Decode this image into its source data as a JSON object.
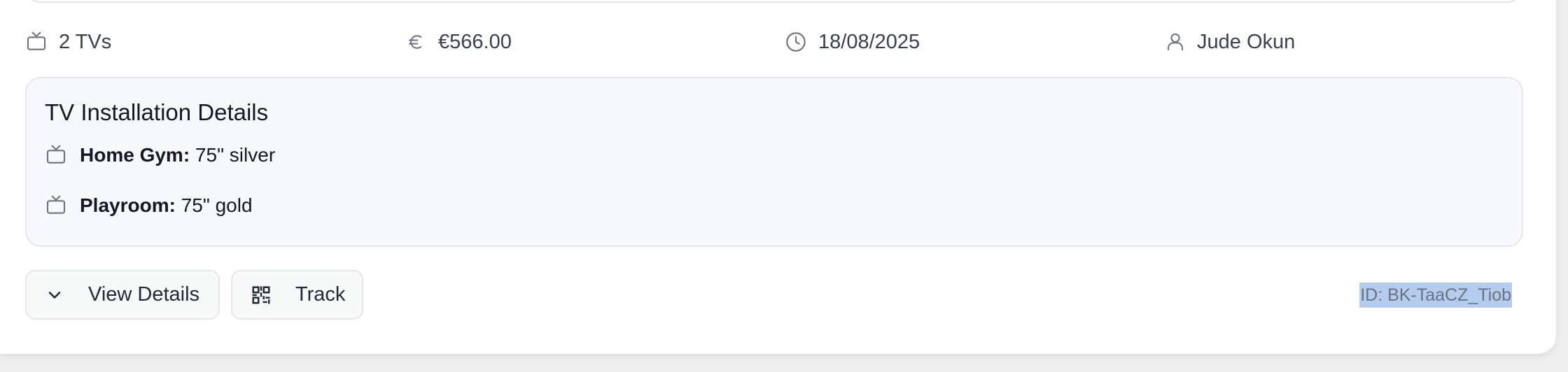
{
  "booking": {
    "tv_count": "2 TVs",
    "price": "€566.00",
    "date": "18/08/2025",
    "customer": "Jude Okun",
    "id_label": "ID: BK-TaaCZ_Tiob"
  },
  "details": {
    "title": "TV Installation Details",
    "items": [
      {
        "room": "Home Gym:",
        "spec": " 75\" silver"
      },
      {
        "room": "Playroom:",
        "spec": " 75\" gold"
      }
    ]
  },
  "actions": {
    "view_label": "View Details",
    "track_label": "Track"
  },
  "icons": [
    "tv-icon",
    "euro-icon",
    "clock-icon",
    "user-icon",
    "chevron-down-icon",
    "qr-code-icon"
  ],
  "colors": {
    "card": "#ffffff",
    "panel": "#f8f9fb",
    "border": "#e5e7eb",
    "muted_text": "#374151",
    "selection": "#b4cdef"
  }
}
